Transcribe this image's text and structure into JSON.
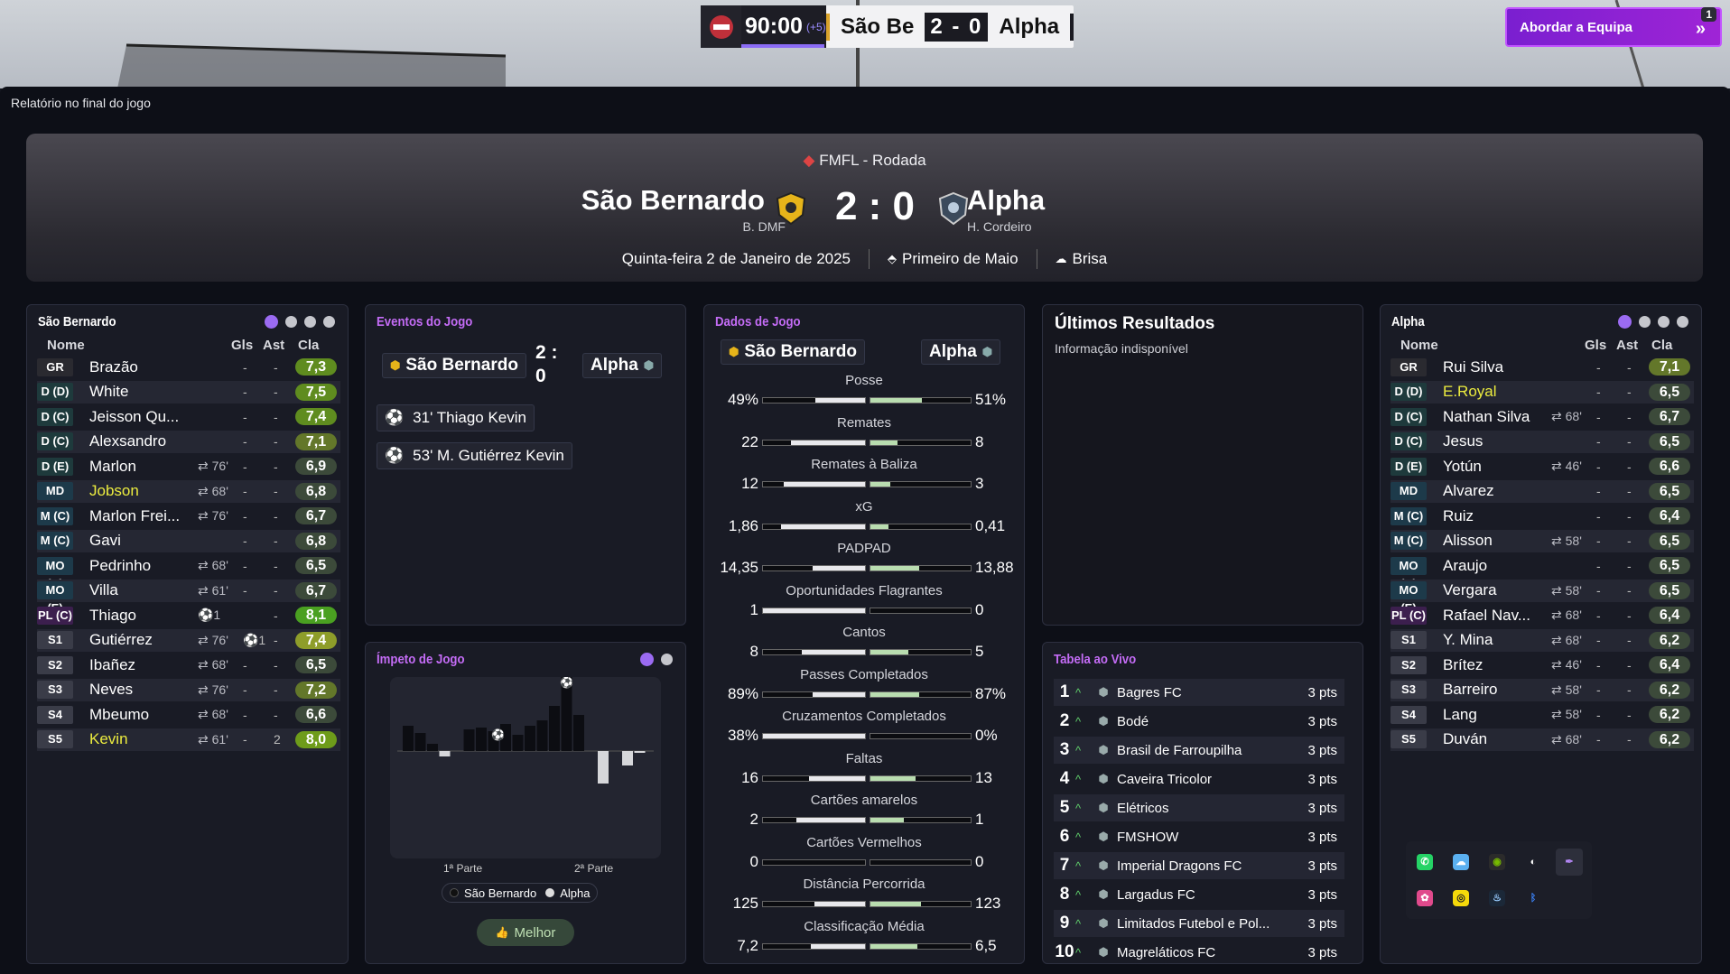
{
  "scoreboard": {
    "time": "90:00",
    "added": "(+5)",
    "home": "São Be",
    "score": "2 - 0",
    "away": "Alpha"
  },
  "approach": {
    "label": "Abordar a Equipa",
    "badge": "1"
  },
  "breadcrumb": "Relatório no final do jogo",
  "header": {
    "competition": "FMFL - Rodada",
    "home": "São Bernardo",
    "home_manager": "B. DMF",
    "away": "Alpha",
    "away_manager": "H. Cordeiro",
    "score": "2 : 0",
    "date": "Quinta-feira 2 de Janeiro de 2025",
    "stadium": "Primeiro de Maio",
    "weather": "Brisa"
  },
  "home_panel": {
    "title": "São Bernardo",
    "cols": {
      "name": "Nome",
      "gls": "Gls",
      "ast": "Ast",
      "cla": "Cla"
    },
    "players": [
      {
        "pos": "GR",
        "name": "Brazão",
        "sub": "",
        "gls": "-",
        "ast": "-",
        "cla": "7,3",
        "hl": false,
        "c": "c-green"
      },
      {
        "pos": "D (D)",
        "name": "White",
        "sub": "",
        "gls": "-",
        "ast": "-",
        "cla": "7,5",
        "hl": false,
        "c": "c-green"
      },
      {
        "pos": "D (C)",
        "name": "Jeisson Qu...",
        "sub": "",
        "gls": "-",
        "ast": "-",
        "cla": "7,4",
        "hl": false,
        "c": "c-green"
      },
      {
        "pos": "D (C)",
        "name": "Alexsandro",
        "sub": "",
        "gls": "-",
        "ast": "-",
        "cla": "7,1",
        "hl": false,
        "c": "c-olive"
      },
      {
        "pos": "D (E)",
        "name": "Marlon",
        "sub": "⇄ 76'",
        "gls": "-",
        "ast": "-",
        "cla": "6,9",
        "hl": false,
        "c": "c-dark"
      },
      {
        "pos": "MD",
        "name": "Jobson",
        "sub": "⇄ 68'",
        "gls": "-",
        "ast": "-",
        "cla": "6,8",
        "hl": true,
        "c": "c-dark"
      },
      {
        "pos": "M (C)",
        "name": "Marlon Frei...",
        "sub": "⇄ 76'",
        "gls": "-",
        "ast": "-",
        "cla": "6,7",
        "hl": false,
        "c": "c-dark"
      },
      {
        "pos": "M (C)",
        "name": "Gavi",
        "sub": "",
        "gls": "-",
        "ast": "-",
        "cla": "6,8",
        "hl": false,
        "c": "c-dark"
      },
      {
        "pos": "MO (D)",
        "name": "Pedrinho",
        "sub": "⇄ 68'",
        "gls": "-",
        "ast": "-",
        "cla": "6,5",
        "hl": false,
        "c": "c-dark"
      },
      {
        "pos": "MO (E)",
        "name": "Villa",
        "sub": "⇄ 61'",
        "gls": "-",
        "ast": "-",
        "cla": "6,7",
        "hl": false,
        "c": "c-dark"
      },
      {
        "pos": "PL (C)",
        "name": "Thiago",
        "sub": "⚽1",
        "gls": "",
        "ast": "-",
        "cla": "8,1",
        "hl": false,
        "c": "c-bright"
      },
      {
        "pos": "S1",
        "name": "Gutiérrez",
        "sub": "⇄ 76'",
        "gls": "⚽1",
        "ast": "-",
        "cla": "7,4",
        "hl": false,
        "c": "c-yel"
      },
      {
        "pos": "S2",
        "name": "Ibañez",
        "sub": "⇄ 68'",
        "gls": "-",
        "ast": "-",
        "cla": "6,5",
        "hl": false,
        "c": "c-dark"
      },
      {
        "pos": "S3",
        "name": "Neves",
        "sub": "⇄ 76'",
        "gls": "-",
        "ast": "-",
        "cla": "7,2",
        "hl": false,
        "c": "c-olive"
      },
      {
        "pos": "S4",
        "name": "Mbeumo",
        "sub": "⇄ 68'",
        "gls": "-",
        "ast": "-",
        "cla": "6,6",
        "hl": false,
        "c": "c-dark"
      },
      {
        "pos": "S5",
        "name": "Kevin",
        "sub": "⇄ 61'",
        "gls": "-",
        "ast": "2",
        "cla": "8,0",
        "hl": true,
        "c": "c-lime"
      }
    ]
  },
  "away_panel": {
    "title": "Alpha",
    "cols": {
      "name": "Nome",
      "gls": "Gls",
      "ast": "Ast",
      "cla": "Cla"
    },
    "players": [
      {
        "pos": "GR",
        "name": "Rui Silva",
        "sub": "",
        "gls": "-",
        "ast": "-",
        "cla": "7,1",
        "hl": false,
        "c": "c-olive"
      },
      {
        "pos": "D (D)",
        "name": "E.Royal",
        "sub": "",
        "gls": "-",
        "ast": "-",
        "cla": "6,5",
        "hl": true,
        "c": "c-dark"
      },
      {
        "pos": "D (C)",
        "name": "Nathan Silva",
        "sub": "⇄ 68'",
        "gls": "-",
        "ast": "-",
        "cla": "6,7",
        "hl": false,
        "c": "c-dark"
      },
      {
        "pos": "D (C)",
        "name": "Jesus",
        "sub": "",
        "gls": "-",
        "ast": "-",
        "cla": "6,5",
        "hl": false,
        "c": "c-dark"
      },
      {
        "pos": "D (E)",
        "name": "Yotún",
        "sub": "⇄ 46'",
        "gls": "-",
        "ast": "-",
        "cla": "6,6",
        "hl": false,
        "c": "c-dark"
      },
      {
        "pos": "MD",
        "name": "Alvarez",
        "sub": "",
        "gls": "-",
        "ast": "-",
        "cla": "6,5",
        "hl": false,
        "c": "c-dark"
      },
      {
        "pos": "M (C)",
        "name": "Ruiz",
        "sub": "",
        "gls": "-",
        "ast": "-",
        "cla": "6,4",
        "hl": false,
        "c": "c-dark"
      },
      {
        "pos": "M (C)",
        "name": "Alisson",
        "sub": "⇄ 58'",
        "gls": "-",
        "ast": "-",
        "cla": "6,5",
        "hl": false,
        "c": "c-dark"
      },
      {
        "pos": "MO (D)",
        "name": "Araujo",
        "sub": "",
        "gls": "-",
        "ast": "-",
        "cla": "6,5",
        "hl": false,
        "c": "c-dark"
      },
      {
        "pos": "MO (E)",
        "name": "Vergara",
        "sub": "⇄ 58'",
        "gls": "-",
        "ast": "-",
        "cla": "6,5",
        "hl": false,
        "c": "c-dark"
      },
      {
        "pos": "PL (C)",
        "name": "Rafael Nav...",
        "sub": "⇄ 68'",
        "gls": "-",
        "ast": "-",
        "cla": "6,4",
        "hl": false,
        "c": "c-dark"
      },
      {
        "pos": "S1",
        "name": "Y. Mina",
        "sub": "⇄ 68'",
        "gls": "-",
        "ast": "-",
        "cla": "6,2",
        "hl": false,
        "c": "c-dark"
      },
      {
        "pos": "S2",
        "name": "Brítez",
        "sub": "⇄ 46'",
        "gls": "-",
        "ast": "-",
        "cla": "6,4",
        "hl": false,
        "c": "c-dark"
      },
      {
        "pos": "S3",
        "name": "Barreiro",
        "sub": "⇄ 58'",
        "gls": "-",
        "ast": "-",
        "cla": "6,2",
        "hl": false,
        "c": "c-dark"
      },
      {
        "pos": "S4",
        "name": "Lang",
        "sub": "⇄ 58'",
        "gls": "-",
        "ast": "-",
        "cla": "6,2",
        "hl": false,
        "c": "c-dark"
      },
      {
        "pos": "S5",
        "name": "Duván",
        "sub": "⇄ 68'",
        "gls": "-",
        "ast": "-",
        "cla": "6,2",
        "hl": false,
        "c": "c-dark"
      }
    ]
  },
  "events": {
    "title": "Eventos do Jogo",
    "home": "São Bernardo",
    "score": "2 :\n0",
    "away": "Alpha",
    "items": [
      "31' Thiago Kevin",
      "53' M. Gutiérrez Kevin"
    ]
  },
  "momentum": {
    "title": "Ímpeto de Jogo",
    "first_half": "1ª Parte",
    "second_half": "2ª Parte",
    "legend_home": "São Bernardo",
    "legend_away": "Alpha",
    "button": "Melhor"
  },
  "stats": {
    "title": "Dados de Jogo",
    "home": "São Bernardo",
    "away": "Alpha",
    "rows": [
      {
        "label": "Posse",
        "home": "49%",
        "away": "51%",
        "hf": 0.49,
        "af": 0.51
      },
      {
        "label": "Remates",
        "home": "22",
        "away": "8",
        "hf": 0.73,
        "af": 0.27
      },
      {
        "label": "Remates à Baliza",
        "home": "12",
        "away": "3",
        "hf": 0.8,
        "af": 0.2
      },
      {
        "label": "xG",
        "home": "1,86",
        "away": "0,41",
        "hf": 0.82,
        "af": 0.18
      },
      {
        "label": "PADPAD",
        "home": "14,35",
        "away": "13,88",
        "hf": 0.51,
        "af": 0.49
      },
      {
        "label": "Oportunidades Flagrantes",
        "home": "1",
        "away": "0",
        "hf": 1,
        "af": 0
      },
      {
        "label": "Cantos",
        "home": "8",
        "away": "5",
        "hf": 0.62,
        "af": 0.38
      },
      {
        "label": "Passes Completados",
        "home": "89%",
        "away": "87%",
        "hf": 0.51,
        "af": 0.49
      },
      {
        "label": "Cruzamentos Completados",
        "home": "38%",
        "away": "0%",
        "hf": 1,
        "af": 0
      },
      {
        "label": "Faltas",
        "home": "16",
        "away": "13",
        "hf": 0.55,
        "af": 0.45
      },
      {
        "label": "Cartões amarelos",
        "home": "2",
        "away": "1",
        "hf": 0.67,
        "af": 0.33
      },
      {
        "label": "Cartões Vermelhos",
        "home": "0",
        "away": "0",
        "hf": 0,
        "af": 0
      },
      {
        "label": "Distância Percorrida",
        "home": "125",
        "away": "123",
        "hf": 0.5,
        "af": 0.5
      },
      {
        "label": "Classificação Média",
        "home": "7,2",
        "away": "6,5",
        "hf": 0.53,
        "af": 0.47
      }
    ]
  },
  "results": {
    "title": "Últimos Resultados",
    "text": "Informação indisponível"
  },
  "live_table": {
    "title": "Tabela ao Vivo",
    "rows": [
      {
        "pos": "1",
        "name": "Bagres FC",
        "pts": "3 pts"
      },
      {
        "pos": "2",
        "name": "Bodé",
        "pts": "3 pts"
      },
      {
        "pos": "3",
        "name": "Brasil de Farroupilha",
        "pts": "3 pts"
      },
      {
        "pos": "4",
        "name": "Caveira Tricolor",
        "pts": "3 pts"
      },
      {
        "pos": "5",
        "name": "Elétricos",
        "pts": "3 pts"
      },
      {
        "pos": "6",
        "name": "FMSHOW",
        "pts": "3 pts"
      },
      {
        "pos": "7",
        "name": "Imperial Dragons FC",
        "pts": "3 pts"
      },
      {
        "pos": "8",
        "name": "Largadus FC",
        "pts": "3 pts"
      },
      {
        "pos": "9",
        "name": "Limitados Futebol e Pol...",
        "pts": "3 pts"
      },
      {
        "pos": "10",
        "name": "Magreláticos FC",
        "pts": "3 pts"
      }
    ]
  },
  "colors": {
    "accent": "#9b6bf2",
    "approach": "#8a1fd4",
    "rating_good": "#5f8c1f",
    "highlight_name": "#ecec3f"
  }
}
